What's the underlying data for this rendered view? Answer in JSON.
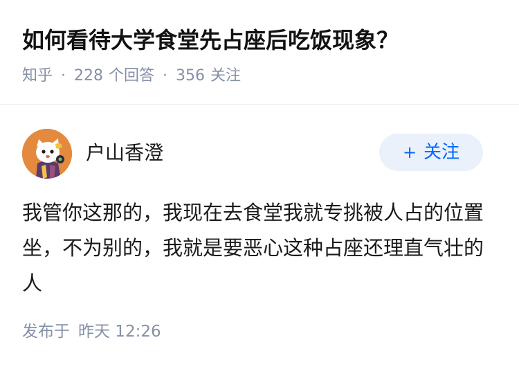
{
  "question": {
    "title": "如何看待大学食堂先占座后吃饭现象？",
    "source": "知乎",
    "separator": "·",
    "answer_count": "228",
    "answer_label": "个回答",
    "follower_count": "356",
    "follower_label": "关注"
  },
  "answer": {
    "author": {
      "name": "户山香澄",
      "avatar_icon": "avatar-image"
    },
    "follow_button": {
      "icon": "plus-icon",
      "icon_glyph": "+",
      "label": "关注"
    },
    "content": "我管你这那的，我现在去食堂我就专挑被人占的位置坐，不为别的，我就是要恶心这种占座还理直气壮的人",
    "publish": {
      "label": "发布于",
      "time": "昨天 12:26"
    }
  },
  "colors": {
    "accent": "#0066ff",
    "follow_bg": "#eaf1fb",
    "meta_text": "#8590a6",
    "title_text": "#121212",
    "divider": "#ebebeb"
  }
}
